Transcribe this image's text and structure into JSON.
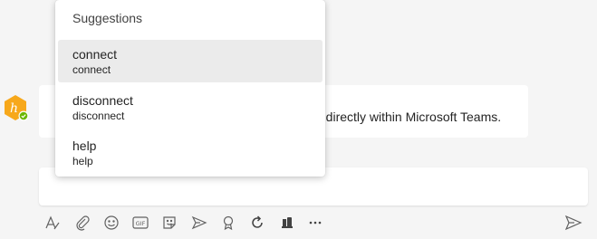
{
  "chat": {
    "message_text": "ns directly within Microsoft Teams."
  },
  "suggestions": {
    "title": "Suggestions",
    "items": [
      {
        "label": "connect",
        "sublabel": "connect",
        "active": true
      },
      {
        "label": "disconnect",
        "sublabel": "disconnect",
        "active": false
      },
      {
        "label": "help",
        "sublabel": "help",
        "active": false
      }
    ]
  },
  "toolbar": {
    "icons": [
      "format-icon",
      "attach-icon",
      "emoji-icon",
      "gif-icon",
      "sticker-icon",
      "schedule-meeting-icon",
      "praise-icon",
      "loop-icon",
      "apps-icon",
      "more-options-icon"
    ],
    "gif_label": "GIF"
  },
  "colors": {
    "avatar_bg": "#f7a81b",
    "status_green": "#6bb700",
    "hover_bg": "#ebebeb",
    "icon_gray": "#616161"
  }
}
